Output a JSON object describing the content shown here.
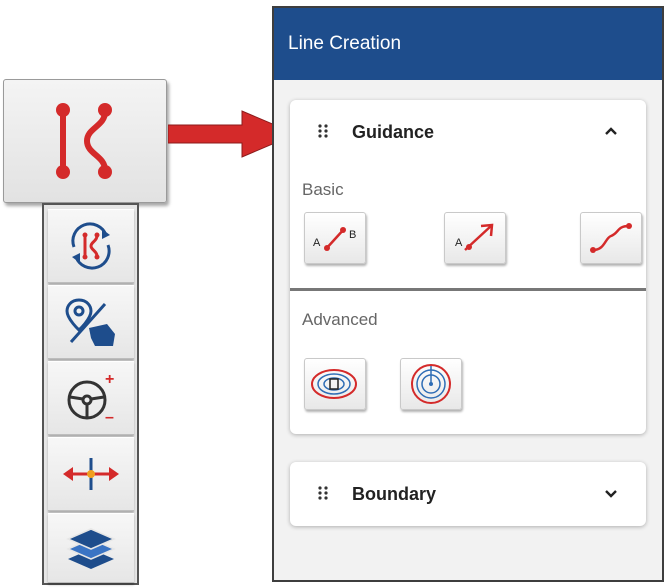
{
  "panel": {
    "title": "Line Creation",
    "sections": {
      "guidance": {
        "title": "Guidance",
        "basic_label": "Basic",
        "advanced_label": "Advanced",
        "basic_tools": [
          "ab-line-icon",
          "a-plus-heading-icon",
          "curve-line-icon"
        ],
        "advanced_tools": [
          "pivot-field-icon",
          "circle-pivot-icon"
        ]
      },
      "boundary": {
        "title": "Boundary"
      }
    }
  },
  "ab_tile": {
    "a": "A",
    "b": "B"
  },
  "heading_tile": {
    "a": "A"
  },
  "toolbar": {
    "main_tool": "guidance-line-icon",
    "items": [
      "line-cycle-icon",
      "field-boundary-icon",
      "steering-wheel-icon",
      "nudge-icon",
      "layers-icon"
    ],
    "steering_plus": "+",
    "steering_minus": "–"
  },
  "colors": {
    "header_blue": "#1e4d8c",
    "accent_red": "#d42a2a",
    "icon_blue": "#1e4d8c"
  }
}
